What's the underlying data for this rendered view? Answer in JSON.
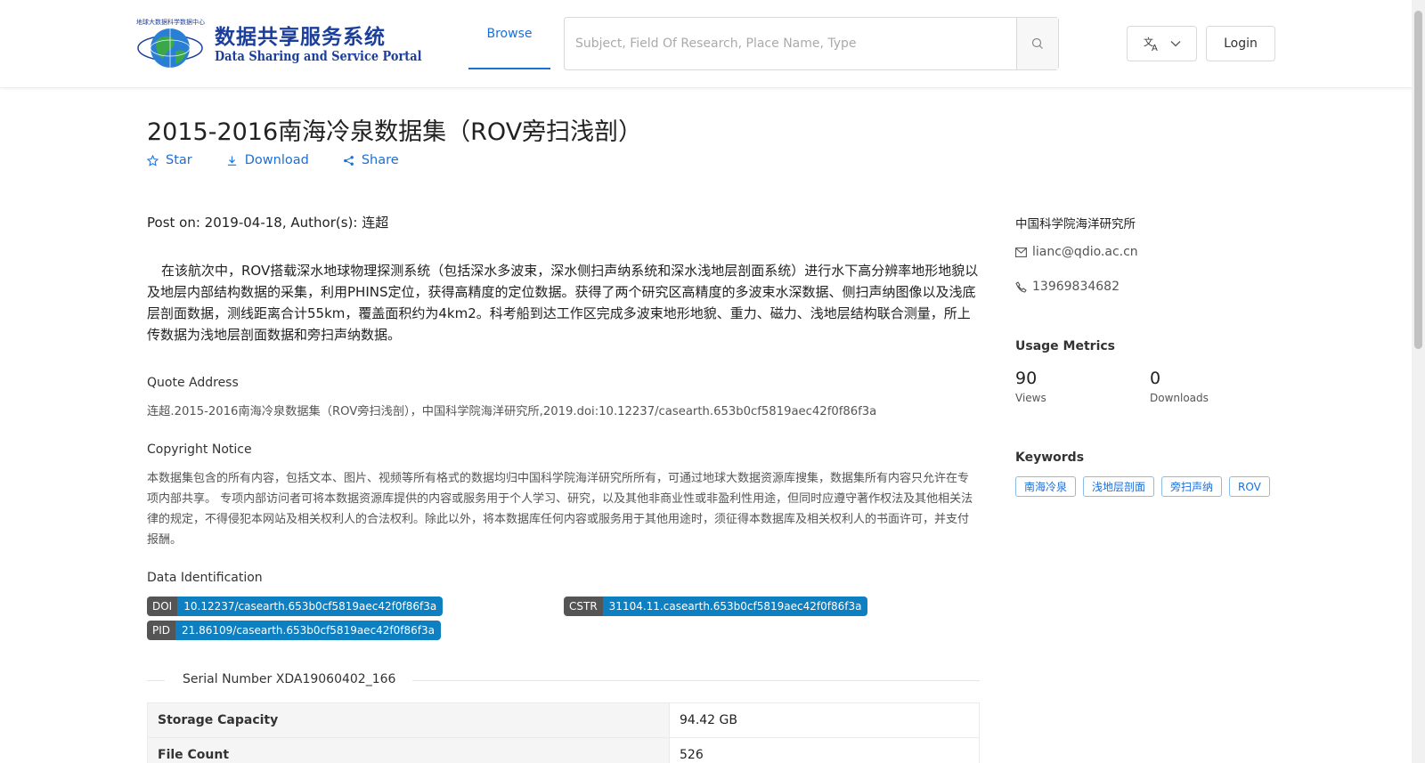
{
  "header": {
    "logo_cn": "数据共享服务系统",
    "logo_en": "Data Sharing and Service Portal",
    "logo_small": "地球大数据科学数据中心",
    "nav_browse": "Browse",
    "search_placeholder": "Subject, Field Of Research, Place Name, Type",
    "login": "Login"
  },
  "dataset": {
    "title": "2015-2016南海冷泉数据集（ROV旁扫浅剖）",
    "actions": {
      "star": "Star",
      "download": "Download",
      "share": "Share"
    },
    "post_on": "Post on: 2019-04-18, Author(s): 连超",
    "description": "在该航次中，ROV搭载深水地球物理探测系统（包括深水多波束，深水侧扫声纳系统和深水浅地层剖面系统）进行水下高分辨率地形地貌以及地层内部结构数据的采集，利用PHINS定位，获得高精度的定位数据。获得了两个研究区高精度的多波束水深数据、侧扫声纳图像以及浅底层剖面数据，测线距离合计55km，覆盖面积约为4km2。科考船到达工作区完成多波束地形地貌、重力、磁力、浅地层结构联合测量，所上传数据为浅地层剖面数据和旁扫声纳数据。",
    "quote_heading": "Quote Address",
    "quote_text": "连超.2015-2016南海冷泉数据集（ROV旁扫浅剖），中国科学院海洋研究所,2019.doi:10.12237/casearth.653b0cf5819aec42f0f86f3a",
    "copyright_heading": "Copyright Notice",
    "copyright_text": "本数据集包含的所有内容，包括文本、图片、视频等所有格式的数据均归中国科学院海洋研究所所有，可通过地球大数据资源库搜集，数据集所有内容只允许在专项内部共享。 专项内部访问者可将本数据资源库提供的内容或服务用于个人学习、研究，以及其他非商业性或非盈利性用途，但同时应遵守著作权法及其他相关法律的规定，不得侵犯本网站及相关权利人的合法权利。除此以外，将本数据库任何内容或服务用于其他用途时，须征得本数据库及相关权利人的书面许可，并支付报酬。",
    "identification_heading": "Data Identification",
    "identifiers": {
      "doi_key": "DOI",
      "doi_val": "10.12237/casearth.653b0cf5819aec42f0f86f3a",
      "cstr_key": "CSTR",
      "cstr_val": "31104.11.casearth.653b0cf5819aec42f0f86f3a",
      "pid_key": "PID",
      "pid_val": "21.86109/casearth.653b0cf5819aec42f0f86f3a"
    },
    "serial_number": "Serial Number XDA19060402_166",
    "info_rows": [
      {
        "key": "Storage Capacity",
        "value": "94.42 GB"
      },
      {
        "key": "File Count",
        "value": "526"
      }
    ]
  },
  "sidebar": {
    "organization": "中国科学院海洋研究所",
    "email": "lianc@qdio.ac.cn",
    "phone": "13969834682",
    "metrics_heading": "Usage Metrics",
    "views_value": "90",
    "views_label": "Views",
    "downloads_value": "0",
    "downloads_label": "Downloads",
    "keywords_heading": "Keywords",
    "keywords": [
      "南海冷泉",
      "浅地层剖面",
      "旁扫声纳",
      "ROV"
    ]
  },
  "colors": {
    "accent": "#1a6fd9",
    "logo_blue": "#1b3f9a",
    "badge_key": "#555555",
    "badge_value": "#0e7fc0"
  },
  "icons": [
    "globe-logo-icon",
    "search-icon",
    "translate-icon",
    "chevron-down-icon",
    "star-icon",
    "download-icon",
    "share-icon",
    "mail-icon",
    "phone-icon"
  ]
}
